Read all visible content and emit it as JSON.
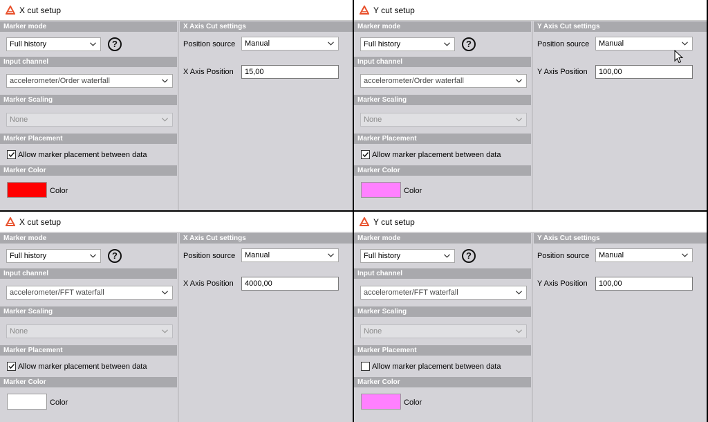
{
  "labels": {
    "marker_mode": "Marker mode",
    "input_channel": "Input channel",
    "marker_scaling": "Marker Scaling",
    "marker_placement": "Marker Placement",
    "marker_color": "Marker Color",
    "allow_between": "Allow marker placement between data",
    "color": "Color",
    "position_source": "Position source",
    "help_glyph": "?"
  },
  "colors": {
    "accent": "#e8502b",
    "header_bg": "#a9a9ad",
    "panel_bg": "#d4d3d8"
  },
  "panels": [
    {
      "title": "X cut setup",
      "marker_mode": "Full history",
      "input_channel": "accelerometer/Order waterfall",
      "marker_scaling": "None",
      "allow_between_checked": true,
      "marker_color": "#ff0000",
      "axis_header": "X Axis Cut settings",
      "position_source": "Manual",
      "axis_position_label": "X Axis Position",
      "axis_position_value": "15,00"
    },
    {
      "title": "Y cut setup",
      "marker_mode": "Full history",
      "input_channel": "accelerometer/Order waterfall",
      "marker_scaling": "None",
      "allow_between_checked": true,
      "marker_color": "#ff80ff",
      "axis_header": "Y Axis Cut settings",
      "position_source": "Manual",
      "axis_position_label": "Y Axis Position",
      "axis_position_value": "100,00"
    },
    {
      "title": "X cut setup",
      "marker_mode": "Full history",
      "input_channel": "accelerometer/FFT waterfall",
      "marker_scaling": "None",
      "allow_between_checked": true,
      "marker_color": "#ffffff",
      "axis_header": "X Axis Cut settings",
      "position_source": "Manual",
      "axis_position_label": "X Axis Position",
      "axis_position_value": "4000,00"
    },
    {
      "title": "Y cut setup",
      "marker_mode": "Full history",
      "input_channel": "accelerometer/FFT waterfall",
      "marker_scaling": "None",
      "allow_between_checked": false,
      "marker_color": "#ff80ff",
      "axis_header": "Y Axis Cut settings",
      "position_source": "Manual",
      "axis_position_label": "Y Axis Position",
      "axis_position_value": "100,00"
    }
  ]
}
